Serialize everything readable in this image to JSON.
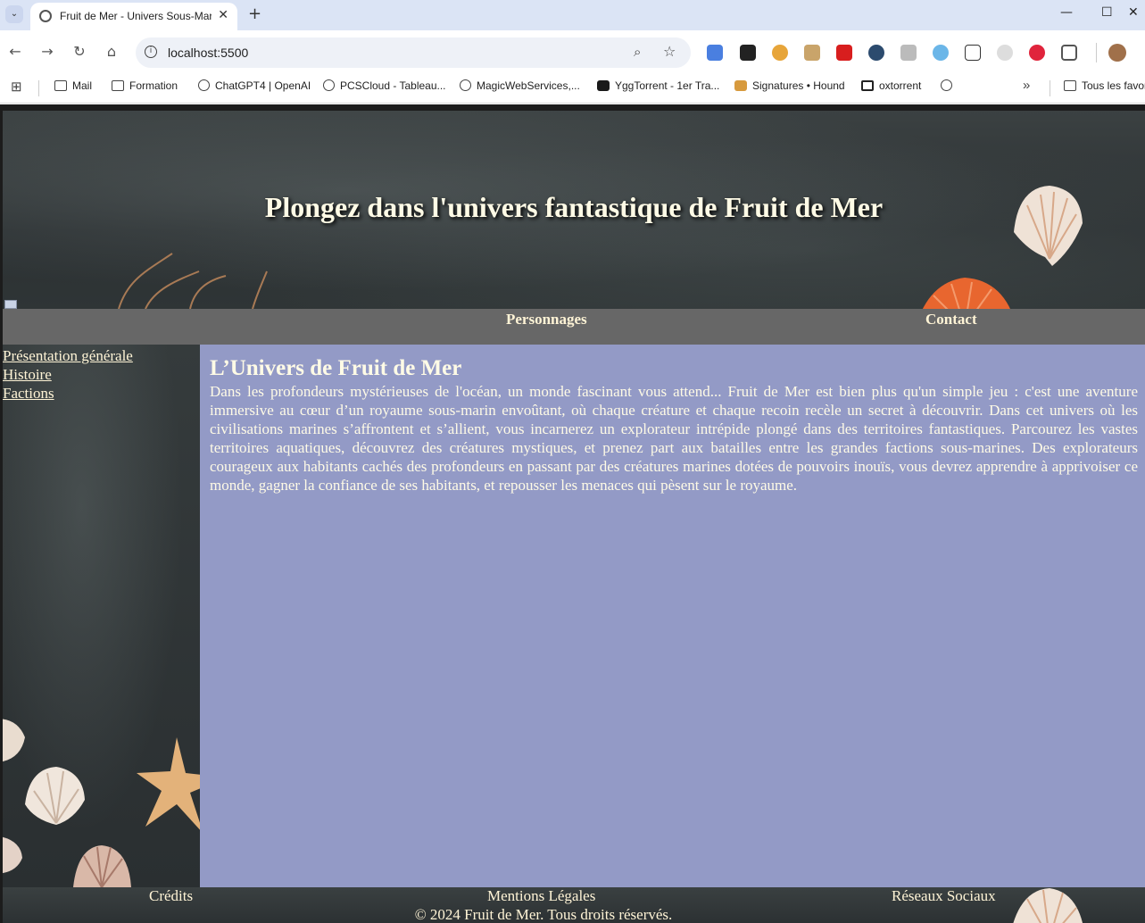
{
  "browser": {
    "tab_title": "Fruit de Mer - Univers Sous-Marin",
    "url": "localhost:5500",
    "bookmarks": [
      {
        "label": "Mail",
        "icon": "folder-icon"
      },
      {
        "label": "Formation",
        "icon": "folder-icon"
      },
      {
        "label": "ChatGPT4 | OpenAI",
        "icon": "openai-icon"
      },
      {
        "label": "PCSCloud - Tableau...",
        "icon": "globe-icon"
      },
      {
        "label": "MagicWebServices,...",
        "icon": "globe-icon"
      },
      {
        "label": "YggTorrent - 1er Tra...",
        "icon": "ygg-icon"
      },
      {
        "label": "Signatures • Hound",
        "icon": "hound-icon"
      },
      {
        "label": "oxtorrent",
        "icon": "oxtorrent-icon"
      }
    ],
    "other_bookmarks": "Tous les favoris"
  },
  "header": {
    "title": "Plongez dans l'univers fantastique de Fruit de Mer"
  },
  "topnav": {
    "characters": "Personnages",
    "contact": "Contact"
  },
  "sidebar": {
    "items": [
      "Présentation générale",
      "Histoire",
      "Factions"
    ]
  },
  "main": {
    "heading": "L’Univers de Fruit de Mer",
    "paragraph": "Dans les profondeurs mystérieuses de l'océan, un monde fascinant vous attend... Fruit de Mer est bien plus qu'un simple jeu : c'est une aventure immersive au cœur d’un royaume sous-marin envoûtant, où chaque créature et chaque recoin recèle un secret à découvrir. Dans cet univers où les civilisations marines s’affrontent et s’allient, vous incarnerez un explorateur intrépide plongé dans des territoires fantastiques. Parcourez les vastes territoires aquatiques, découvrez des créatures mystiques, et prenez part aux batailles entre les grandes factions sous-marines. Des explorateurs courageux aux habitants cachés des profondeurs en passant par des créatures marines dotées de pouvoirs inouïs, vous devrez apprendre à apprivoiser ce monde, gagner la confiance de ses habitants, et repousser les menaces qui pèsent sur le royaume."
  },
  "footer": {
    "credits": "Crédits",
    "legal": "Mentions Légales",
    "social": "Réseaux Sociaux",
    "copyright": "© 2024 Fruit de Mer. Tous droits réservés."
  },
  "colors": {
    "main_bg": "#939ac6",
    "nav_bg": "#676767",
    "text": "#fff4d6"
  }
}
